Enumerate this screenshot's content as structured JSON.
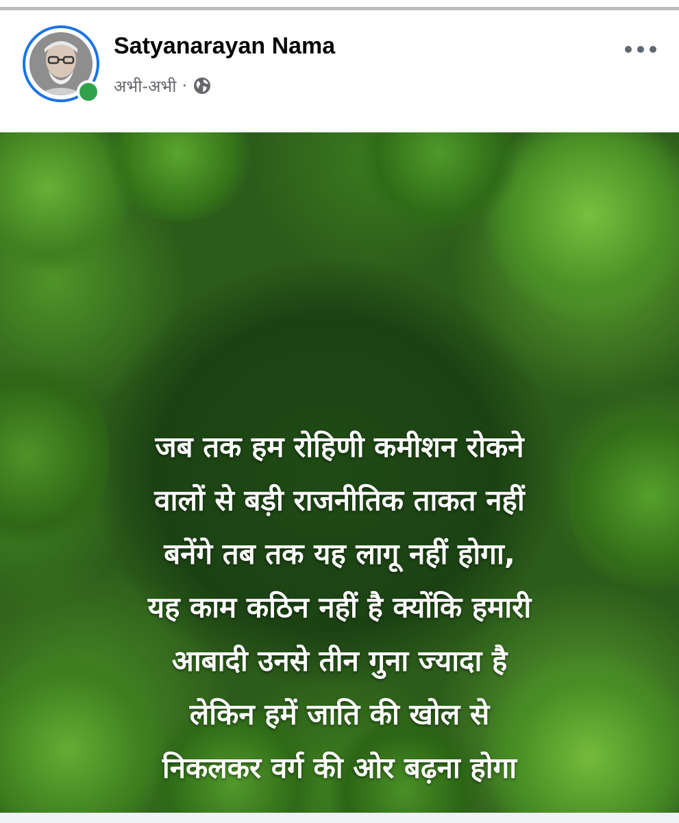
{
  "post": {
    "author_name": "Satyanarayan Nama",
    "timestamp": "अभी-अभी",
    "separator": "·",
    "privacy_icon": "globe-icon",
    "more_icon": "more-options-icon",
    "online_status_color": "#31a24c",
    "ring_color": "#1b74e4"
  },
  "image_text": {
    "lines": [
      "जब तक हम रोहिणी कमीशन रोकने",
      "वालों से बड़ी राजनीतिक ताकत नहीं",
      "बनेंगे तब तक यह लागू नहीं होगा,",
      "यह काम कठिन नहीं है क्योंकि हमारी",
      "आबादी उनसे तीन गुना ज्यादा है",
      "लेकिन हमें जाति की खोल से",
      "निकलकर वर्ग की ओर बढ़ना होगा"
    ]
  }
}
